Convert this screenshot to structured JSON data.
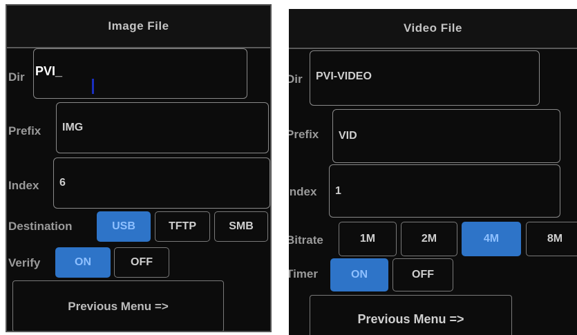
{
  "image_file": {
    "title": "Image File",
    "dir": {
      "label": "Dir",
      "value": "PVI_"
    },
    "prefix": {
      "label": "Prefix",
      "value": "IMG"
    },
    "index": {
      "label": "Index",
      "value": "6"
    },
    "destination": {
      "label": "Destination",
      "options": [
        "USB",
        "TFTP",
        "SMB"
      ],
      "selected": "USB"
    },
    "verify": {
      "label": "Verify",
      "options": [
        "ON",
        "OFF"
      ],
      "selected": "ON"
    },
    "previous_menu": "Previous Menu =>"
  },
  "video_file": {
    "title": "Video File",
    "dir": {
      "label": "Dir",
      "value": "PVI-VIDEO"
    },
    "prefix": {
      "label": "Prefix",
      "value": "VID"
    },
    "index": {
      "label": "Index",
      "value": "1"
    },
    "bitrate": {
      "label": "Bitrate",
      "options": [
        "1M",
        "2M",
        "4M",
        "8M"
      ],
      "selected": "4M"
    },
    "timer": {
      "label": "Timer",
      "options": [
        "ON",
        "OFF"
      ],
      "selected": "ON"
    },
    "previous_menu": "Previous Menu =>"
  },
  "colors": {
    "panel_bg": "#0c0c0c",
    "selected": "#2e74c8",
    "border": "#8a8a8a"
  }
}
